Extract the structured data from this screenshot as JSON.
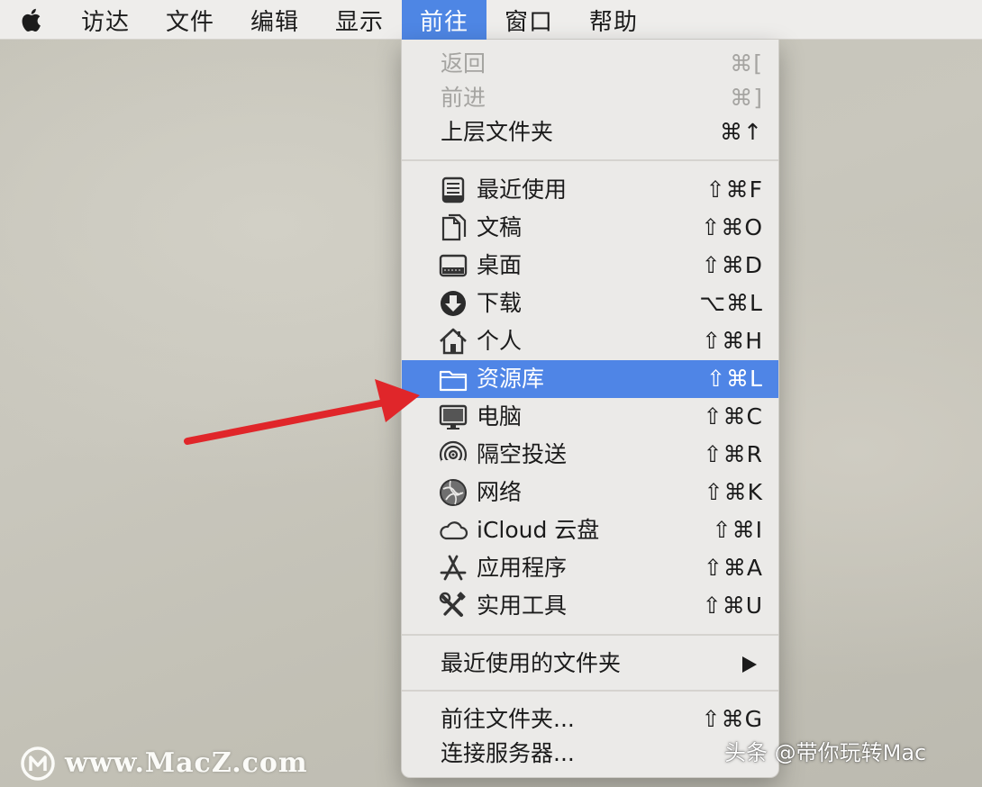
{
  "menubar": {
    "apple_icon": "apple-logo-icon",
    "items": [
      {
        "label": "访达"
      },
      {
        "label": "文件"
      },
      {
        "label": "编辑"
      },
      {
        "label": "显示"
      },
      {
        "label": "前往",
        "active": true
      },
      {
        "label": "窗口"
      },
      {
        "label": "帮助"
      }
    ]
  },
  "go_menu": {
    "items": [
      {
        "label": "返回",
        "shortcut": "⌘[",
        "enabled": false
      },
      {
        "label": "前进",
        "shortcut": "⌘]",
        "enabled": false
      },
      {
        "label": "上层文件夹",
        "shortcut": "⌘↑",
        "enabled": true
      },
      {
        "label": "最近使用",
        "shortcut": "⇧⌘F",
        "icon": "recents-icon"
      },
      {
        "label": "文稿",
        "shortcut": "⇧⌘O",
        "icon": "documents-icon"
      },
      {
        "label": "桌面",
        "shortcut": "⇧⌘D",
        "icon": "desktop-icon"
      },
      {
        "label": "下载",
        "shortcut": "⌥⌘L",
        "icon": "downloads-icon"
      },
      {
        "label": "个人",
        "shortcut": "⇧⌘H",
        "icon": "home-icon"
      },
      {
        "label": "资源库",
        "shortcut": "⇧⌘L",
        "icon": "folder-icon",
        "highlighted": true
      },
      {
        "label": "电脑",
        "shortcut": "⇧⌘C",
        "icon": "computer-icon"
      },
      {
        "label": "隔空投送",
        "shortcut": "⇧⌘R",
        "icon": "airdrop-icon"
      },
      {
        "label": "网络",
        "shortcut": "⇧⌘K",
        "icon": "network-icon"
      },
      {
        "label": "iCloud 云盘",
        "shortcut": "⇧⌘I",
        "icon": "icloud-icon"
      },
      {
        "label": "应用程序",
        "shortcut": "⇧⌘A",
        "icon": "applications-icon"
      },
      {
        "label": "实用工具",
        "shortcut": "⇧⌘U",
        "icon": "utilities-icon"
      },
      {
        "label": "最近使用的文件夹",
        "submenu": true
      },
      {
        "label": "前往文件夹...",
        "shortcut": "⇧⌘G"
      },
      {
        "label": "连接服务器...",
        "shortcut": ""
      }
    ]
  },
  "watermark": {
    "text": "www.MacZ.com"
  },
  "attribution": {
    "text": "头条 @带你玩转Mac"
  },
  "colors": {
    "highlight": "#4f85e6",
    "arrow": "#e0262a",
    "menu_background": "#ebeae8"
  }
}
